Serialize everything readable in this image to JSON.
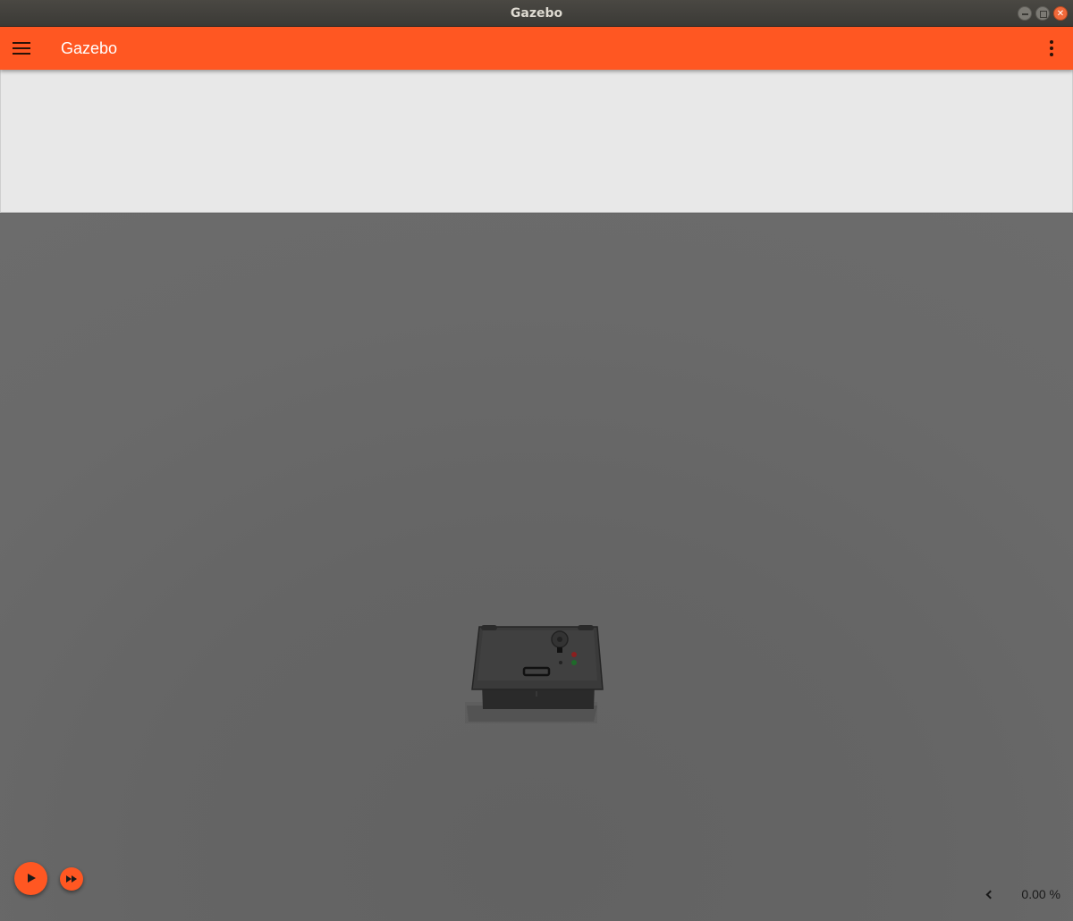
{
  "window": {
    "title": "Gazebo"
  },
  "appbar": {
    "title": "Gazebo",
    "color": "#ff5722",
    "menu_icon": "hamburger-menu-icon",
    "overflow_icon": "kebab-menu-icon"
  },
  "playback": {
    "play_icon": "play-icon",
    "step_icon": "fast-forward-icon"
  },
  "stats": {
    "real_time_factor": "0.00 %",
    "toggle_icon": "chevron-left-icon"
  },
  "colors": {
    "accent": "#ff5722",
    "panel": "#e8e8e8",
    "scene": "#666666"
  }
}
